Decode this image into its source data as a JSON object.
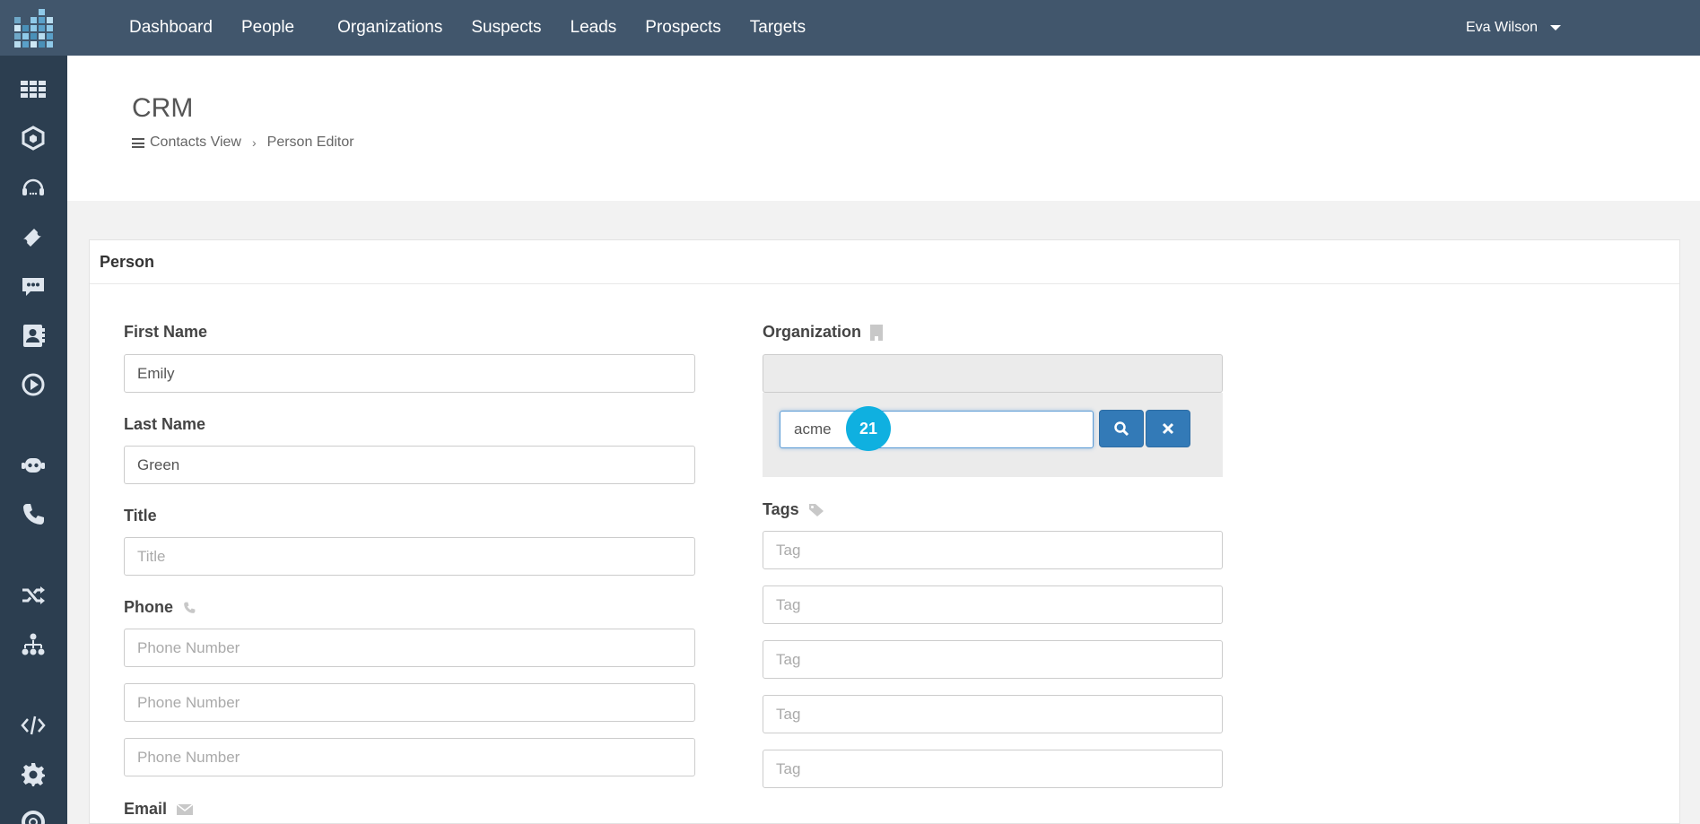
{
  "nav": {
    "items": [
      "Dashboard",
      "People",
      "Organizations",
      "Suspects",
      "Leads",
      "Prospects",
      "Targets"
    ],
    "user": "Eva Wilson"
  },
  "header": {
    "title": "CRM",
    "breadcrumb": [
      "Contacts View",
      "Person Editor"
    ]
  },
  "sidebar": {
    "icons": [
      "apps-grid-icon",
      "hexagon-icon",
      "headset-icon",
      "ticket-icon",
      "chat-icon",
      "contact-card-icon",
      "play-icon",
      "robot-icon",
      "phone-icon",
      "shuffle-icon",
      "hierarchy-icon",
      "code-icon",
      "gear-icon",
      "lifebuoy-icon"
    ]
  },
  "form": {
    "panel_title": "Person",
    "first_name": {
      "label": "First Name",
      "value": "Emily"
    },
    "last_name": {
      "label": "Last Name",
      "value": "Green"
    },
    "title": {
      "label": "Title",
      "placeholder": "Title"
    },
    "phone": {
      "label": "Phone",
      "placeholder": "Phone Number"
    },
    "email": {
      "label": "Email"
    },
    "organization": {
      "label": "Organization",
      "search_value": "acme"
    },
    "tags": {
      "label": "Tags",
      "placeholder": "Tag"
    }
  },
  "badge": "21",
  "colors": {
    "topbar": "#41566c",
    "sidebar": "#2c3e50",
    "primary_button": "#337ab7",
    "badge": "#0fb0e0"
  }
}
